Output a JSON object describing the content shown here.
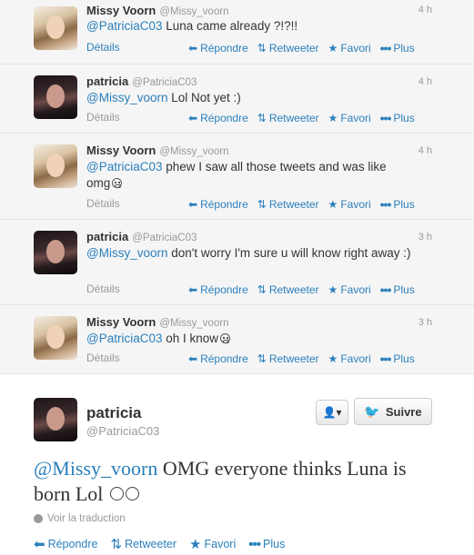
{
  "tweets": [
    {
      "name": "Missy Voorn",
      "handle": "@Missy_voorn",
      "time": "4 h",
      "mention": "@PatriciaC03",
      "text": " Luna came already ?!?!!",
      "details": "Détails"
    },
    {
      "name": "patricia",
      "handle": "@PatriciaC03",
      "time": "4 h",
      "mention": "@Missy_voorn",
      "text": " Lol Not yet :)",
      "details": "Détails"
    },
    {
      "name": "Missy Voorn",
      "handle": "@Missy_voorn",
      "time": "4 h",
      "mention": "@PatriciaC03",
      "text": " phew I saw all those tweets and was like omg",
      "details": "Détails"
    },
    {
      "name": "patricia",
      "handle": "@PatriciaC03",
      "time": "3 h",
      "mention": "@Missy_voorn",
      "text": " don't worry I'm sure u will know right away :)",
      "details": "Détails"
    },
    {
      "name": "Missy Voorn",
      "handle": "@Missy_voorn",
      "time": "3 h",
      "mention": "@PatriciaC03",
      "text": " oh I know",
      "details": "Détails"
    }
  ],
  "actions": {
    "reply": "Répondre",
    "retweet": "Retweeter",
    "favorite": "Favori",
    "more": "Plus"
  },
  "main": {
    "name": "patricia",
    "handle": "@PatriciaC03",
    "follow_label": "Suivre",
    "mention": "@Missy_voorn",
    "text": " OMG everyone thinks Luna is born Lol",
    "translate": "Voir la traduction"
  },
  "colors": {
    "link": "#2a7fbc",
    "background": "#f5f5f5",
    "muted": "#999999"
  },
  "icons": [
    "reply-icon",
    "retweet-icon",
    "star-icon",
    "dots-icon",
    "user-icon",
    "bird-icon",
    "globe-icon"
  ]
}
